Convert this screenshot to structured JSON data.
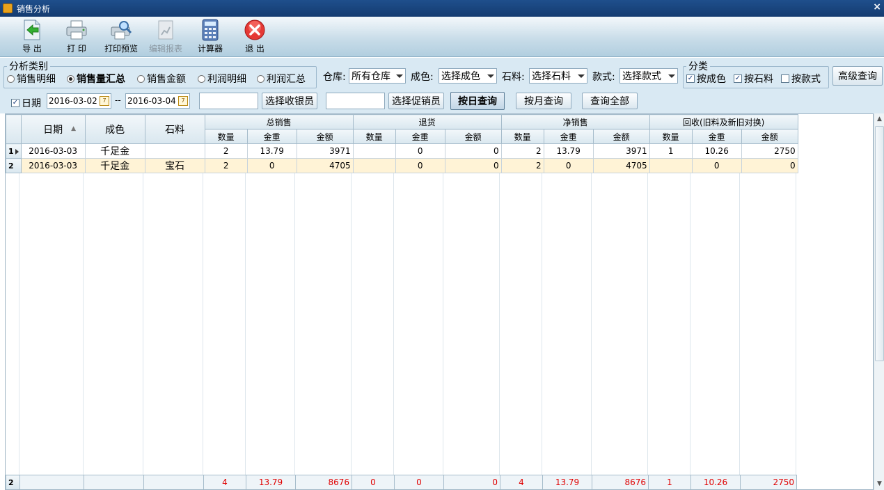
{
  "window": {
    "title": "销售分析",
    "close_glyph": "×"
  },
  "toolbar": {
    "export": "导 出",
    "print": "打 印",
    "print_preview": "打印预览",
    "edit_report": "编辑报表",
    "calculator": "计算器",
    "exit": "退 出"
  },
  "analysis": {
    "legend": "分析类别",
    "options": [
      "销售明细",
      "销售量汇总",
      "销售金额",
      "利润明细",
      "利润汇总"
    ],
    "selected": "销售量汇总"
  },
  "filters": {
    "warehouse_label": "仓库:",
    "warehouse_value": "所有仓库",
    "color_label": "成色:",
    "color_value": "选择成色",
    "stone_label": "石料:",
    "stone_value": "选择石料",
    "style_label": "款式:",
    "style_value": "选择款式",
    "classify_legend": "分类",
    "by_color": "按成色",
    "by_stone": "按石料",
    "by_style": "按款式",
    "advanced": "高级查询",
    "date_label": "日期",
    "date_from": "2016-03-02",
    "date_to": "2016-03-04",
    "date_sep": "--",
    "calendar_glyph": "7",
    "select_cashier": "选择收银员",
    "select_promoter": "选择促销员",
    "query_day": "按日查询",
    "query_month": "按月查询",
    "query_all": "查询全部",
    "check_glyph": "✓"
  },
  "grid": {
    "headers": {
      "date": "日期",
      "color": "成色",
      "stone": "石料",
      "total_sales": "总销售",
      "returns": "退货",
      "net_sales": "净销售",
      "recycle": "回收(旧料及新旧对换)",
      "qty": "数量",
      "weight": "金重",
      "amount": "金额"
    },
    "rows": [
      {
        "index": "1",
        "date": "2016-03-03",
        "color": "千足金",
        "stone": "",
        "t_qty": "2",
        "t_weight": "13.79",
        "t_amount": "3971",
        "r_qty": "",
        "r_weight": "0",
        "r_amount": "0",
        "n_qty": "2",
        "n_weight": "13.79",
        "n_amount": "3971",
        "c_qty": "1",
        "c_weight": "10.26",
        "c_amount": "2750"
      },
      {
        "index": "2",
        "date": "2016-03-03",
        "color": "千足金",
        "stone": "宝石",
        "t_qty": "2",
        "t_weight": "0",
        "t_amount": "4705",
        "r_qty": "",
        "r_weight": "0",
        "r_amount": "0",
        "n_qty": "2",
        "n_weight": "0",
        "n_amount": "4705",
        "c_qty": "",
        "c_weight": "0",
        "c_amount": "0"
      }
    ],
    "summary": {
      "index": "2",
      "t_qty": "4",
      "t_weight": "13.79",
      "t_amount": "8676",
      "r_qty": "0",
      "r_weight": "0",
      "r_amount": "0",
      "n_qty": "4",
      "n_weight": "13.79",
      "n_amount": "8676",
      "c_qty": "1",
      "c_weight": "10.26",
      "c_amount": "2750"
    },
    "sort_glyph": "▲"
  }
}
